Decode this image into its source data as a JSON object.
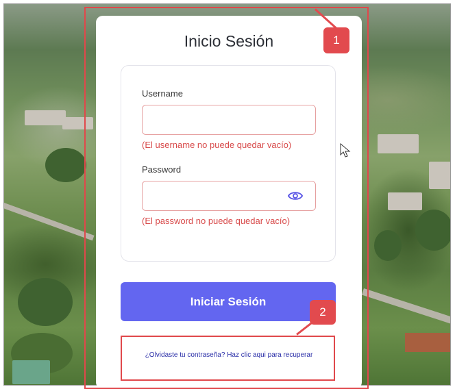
{
  "login": {
    "title": "Inicio Sesión",
    "username_label": "Username",
    "username_value": "",
    "username_error": "(El username no puede quedar vacío)",
    "password_label": "Password",
    "password_value": "",
    "password_error": "(El password no puede quedar vacío)",
    "submit_label": "Iniciar Sesión",
    "forgot_link": "¿Olvidaste tu contraseña? Haz clic aqui para recuperar"
  },
  "annotations": {
    "marker_1": "1",
    "marker_2": "2"
  },
  "icons": {
    "password_toggle": "eye-icon",
    "pointer": "mouse-cursor-icon"
  },
  "colors": {
    "accent": "#6366f0",
    "error": "#d84b4b",
    "annotation": "#e24a4e",
    "link": "#2b2fa8"
  }
}
